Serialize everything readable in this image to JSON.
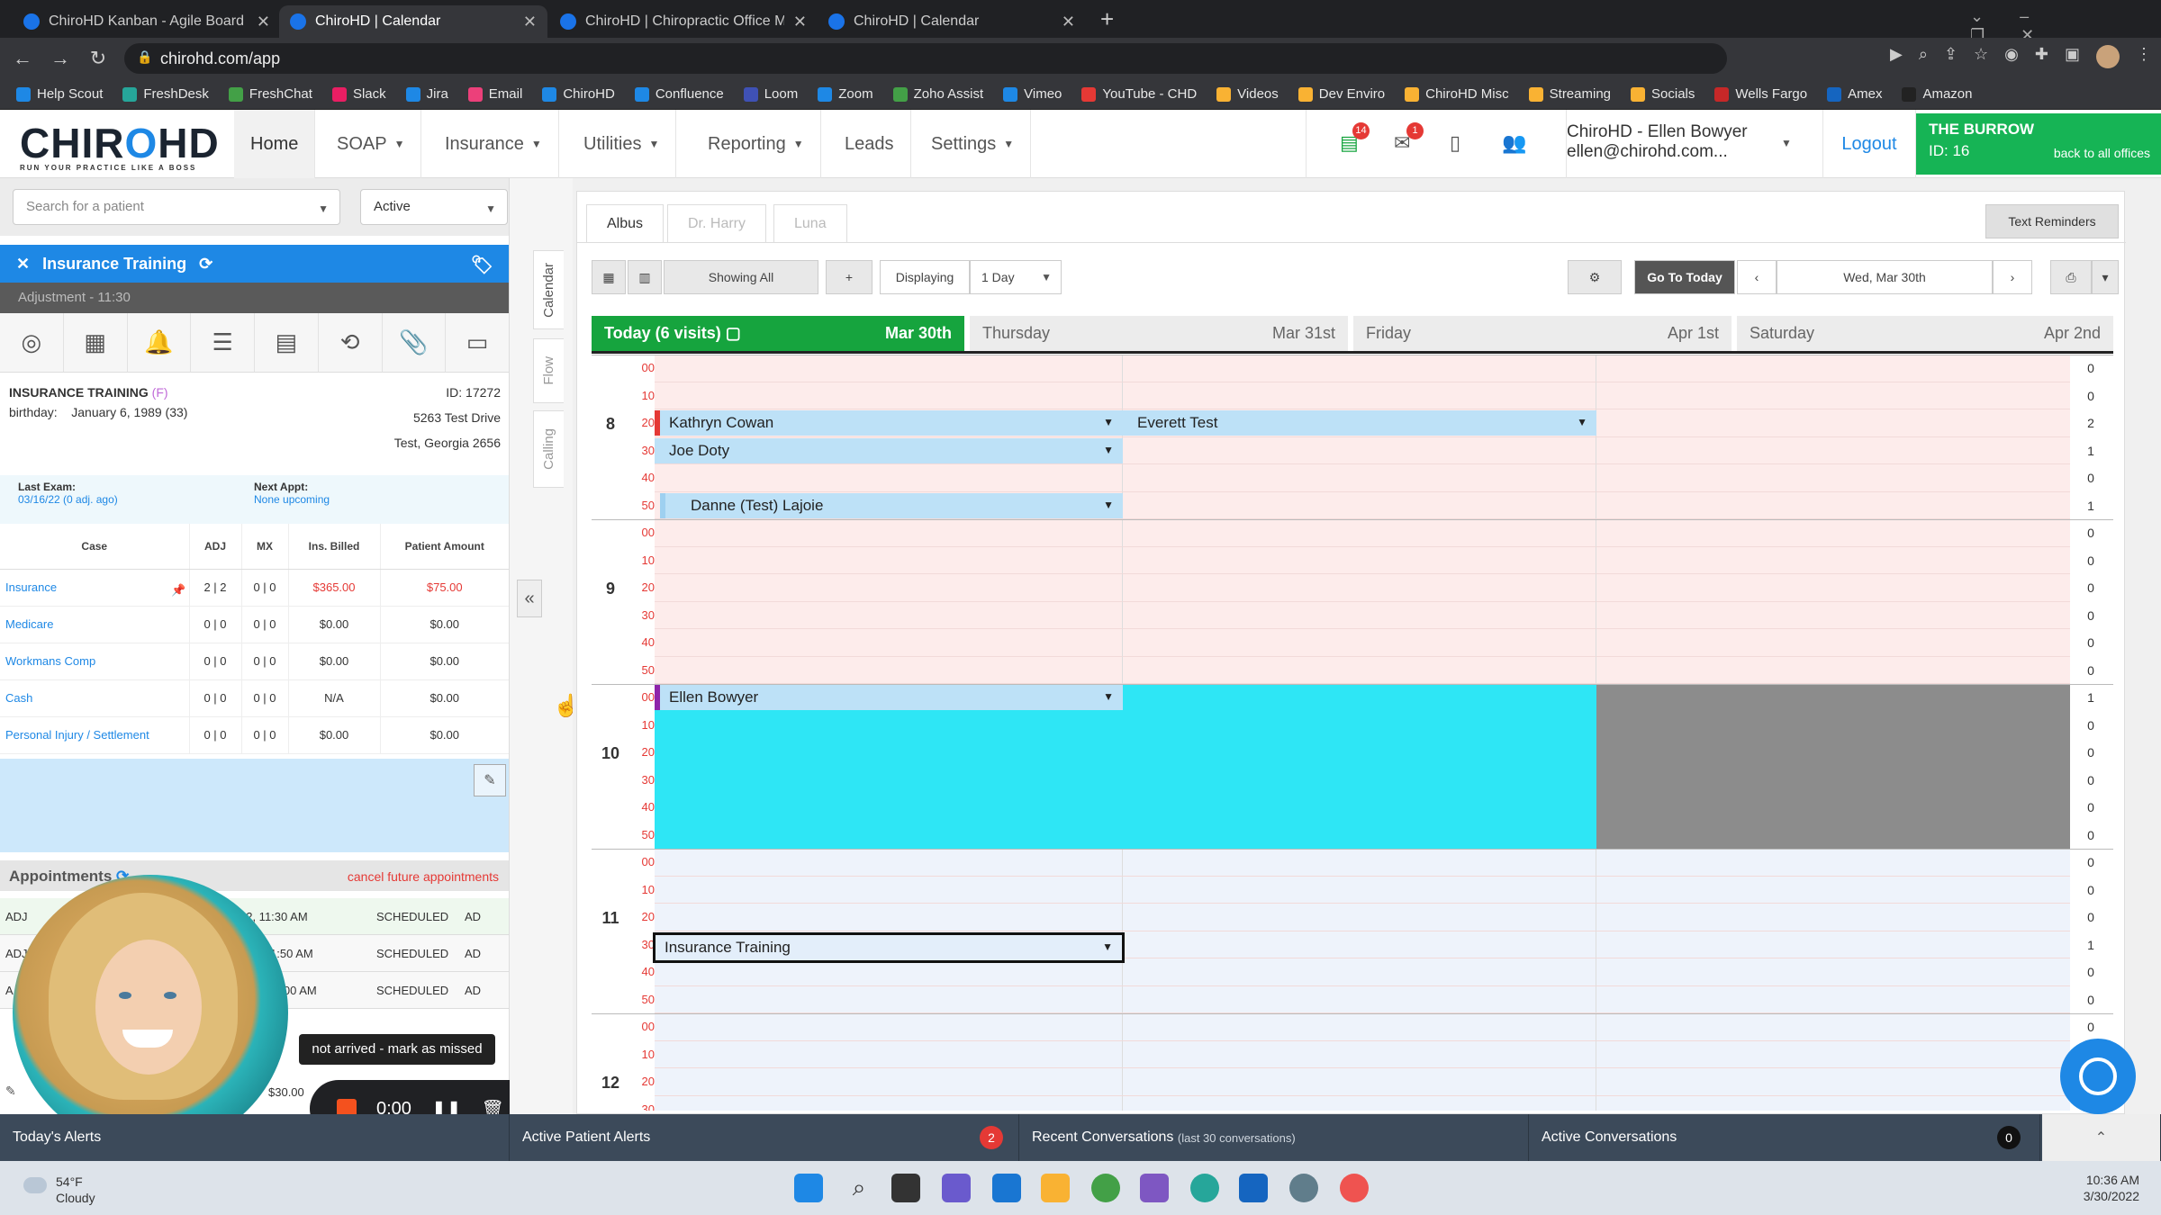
{
  "browser": {
    "tabs": [
      {
        "title": "ChiroHD Kanban - Agile Board -",
        "active": false
      },
      {
        "title": "ChiroHD | Calendar",
        "active": true
      },
      {
        "title": "ChiroHD | Chiropractic Office Ma",
        "active": false
      },
      {
        "title": "ChiroHD | Calendar",
        "active": false
      }
    ],
    "url": "chirohd.com/app",
    "bookmarks": [
      "Help Scout",
      "FreshDesk",
      "FreshChat",
      "Slack",
      "Jira",
      "Email",
      "ChiroHD",
      "Confluence",
      "Loom",
      "Zoom",
      "Zoho Assist",
      "Vimeo",
      "YouTube - CHD",
      "Videos",
      "Dev Enviro",
      "ChiroHD Misc",
      "Streaming",
      "Socials",
      "Wells Fargo",
      "Amex",
      "Amazon"
    ]
  },
  "app": {
    "logo": "CHIROHD",
    "tagline": "RUN YOUR PRACTICE LIKE A BOSS",
    "menu": [
      "Home",
      "SOAP",
      "Insurance",
      "Utilities",
      "Reporting",
      "Leads",
      "Settings"
    ],
    "badges": {
      "alerts": "14",
      "messages": "1"
    },
    "user_name": "ChiroHD - Ellen Bowyer",
    "user_email": "ellen@chirohd.com...",
    "logout": "Logout",
    "office_name": "THE BURROW",
    "office_id": "ID: 16",
    "office_back": "back to all offices"
  },
  "left": {
    "search_placeholder": "Search for a patient",
    "status_filter": "Active",
    "patient_bar": "Insurance Training",
    "adjustment": "Adjustment - 11:30",
    "patient_name": "INSURANCE TRAINING",
    "gender": "(F)",
    "patient_id": "ID: 17272",
    "birthday_label": "birthday:",
    "birthday": "January 6, 1989 (33)",
    "address1": "5263 Test Drive",
    "address2": "Test, Georgia 2656",
    "last_exam_label": "Last Exam:",
    "last_exam": "03/16/22 (0 adj. ago)",
    "next_appt_label": "Next Appt:",
    "next_appt": "None upcoming",
    "case_headers": [
      "Case",
      "ADJ",
      "MX",
      "Ins. Billed",
      "Patient Amount"
    ],
    "cases": [
      {
        "name": "Insurance",
        "adj": "2 | 2",
        "mx": "0 | 0",
        "billed": "$365.00",
        "amount": "$75.00"
      },
      {
        "name": "Medicare",
        "adj": "0 | 0",
        "mx": "0 | 0",
        "billed": "$0.00",
        "amount": "$0.00"
      },
      {
        "name": "Workmans Comp",
        "adj": "0 | 0",
        "mx": "0 | 0",
        "billed": "$0.00",
        "amount": "$0.00"
      },
      {
        "name": "Cash",
        "adj": "0 | 0",
        "mx": "0 | 0",
        "billed": "N/A",
        "amount": "$0.00"
      },
      {
        "name": "Personal Injury / Settlement",
        "adj": "0 | 0",
        "mx": "0 | 0",
        "billed": "$0.00",
        "amount": "$0.00"
      }
    ],
    "appointments_title": "Appointments",
    "cancel_future": "cancel future appointments",
    "appointments": [
      {
        "type": "ADJ",
        "time": "22, 11:30 AM",
        "status": "SCHEDULED",
        "by": "AD"
      },
      {
        "type": "ADJ",
        "time": "1:50 AM",
        "status": "SCHEDULED",
        "by": "AD"
      },
      {
        "type": "A",
        "time": "1:00 AM",
        "status": "SCHEDULED",
        "by": "AD"
      }
    ],
    "footer_amount": "$30.00",
    "missed_tooltip": "not arrived - mark as missed",
    "rec_time": "0:00"
  },
  "sidetabs": [
    "Calendar",
    "Flow",
    "Calling"
  ],
  "calendar": {
    "providers": [
      "Albus",
      "Dr. Harry",
      "Luna"
    ],
    "text_reminders": "Text Reminders",
    "showing": "Showing All",
    "plus": "+",
    "displaying_label": "Displaying",
    "displaying_value": "1 Day",
    "go_today": "Go To Today",
    "date": "Wed, Mar 30th",
    "days": [
      {
        "name": "Today (6 visits)",
        "date": "Mar 30th"
      },
      {
        "name": "Thursday",
        "date": "Mar 31st"
      },
      {
        "name": "Friday",
        "date": "Apr 1st"
      },
      {
        "name": "Saturday",
        "date": "Apr 2nd"
      }
    ],
    "hours": [
      "8",
      "9",
      "10",
      "11",
      "12"
    ],
    "minutes": [
      "00",
      "10",
      "20",
      "30",
      "40",
      "50"
    ],
    "counts": [
      "0",
      "0",
      "2",
      "1",
      "0",
      "1",
      "0",
      "0",
      "0",
      "0",
      "0",
      "0",
      "1",
      "0",
      "0",
      "0",
      "0",
      "0",
      "0",
      "0",
      "0",
      "1",
      "0",
      "0",
      "0",
      "0"
    ],
    "appointments": [
      {
        "name": "Kathryn Cowan",
        "color": "#e53935"
      },
      {
        "name": "Joe Doty",
        "color": "#bde1f7"
      },
      {
        "name": "Danne (Test) Lajoie",
        "color": "#9ed0f0"
      },
      {
        "name": "Everett Test",
        "color": "#bde1f7"
      },
      {
        "name": "Ellen Bowyer",
        "color": "#8e24aa"
      },
      {
        "name": "Insurance Training",
        "color": "#222"
      }
    ]
  },
  "bottom": {
    "today_alerts": "Today's Alerts",
    "active_patient_alerts": "Active Patient Alerts",
    "apa_count": "2",
    "recent_conv": "Recent Conversations",
    "recent_sub": "(last 30 conversations)",
    "active_conv": "Active Conversations",
    "active_count": "0"
  },
  "taskbar": {
    "temp": "54°F",
    "weather": "Cloudy",
    "time": "10:36 AM",
    "date": "3/30/2022"
  }
}
